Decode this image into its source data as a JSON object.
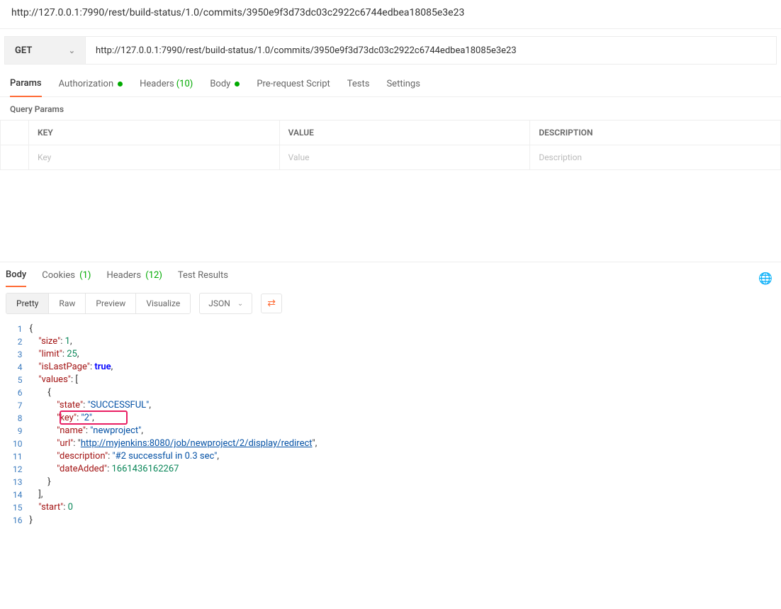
{
  "address_url": "http://127.0.0.1:7990/rest/build-status/1.0/commits/3950e9f3d73dc03c2922c6744edbea18085e3e23",
  "method": "GET",
  "request_url": "http://127.0.0.1:7990/rest/build-status/1.0/commits/3950e9f3d73dc03c2922c6744edbea18085e3e23",
  "req_tabs": {
    "params": "Params",
    "auth": "Authorization",
    "headers": "Headers",
    "headers_count": "(10)",
    "body": "Body",
    "prescript": "Pre-request Script",
    "tests": "Tests",
    "settings": "Settings"
  },
  "query_params_title": "Query Params",
  "table": {
    "key_h": "KEY",
    "value_h": "VALUE",
    "desc_h": "DESCRIPTION",
    "key_ph": "Key",
    "value_ph": "Value",
    "desc_ph": "Description"
  },
  "resp_tabs": {
    "body": "Body",
    "cookies": "Cookies",
    "cookies_count": "(1)",
    "headers": "Headers",
    "headers_count": "(12)",
    "tests": "Test Results"
  },
  "view_modes": {
    "pretty": "Pretty",
    "raw": "Raw",
    "preview": "Preview",
    "visualize": "Visualize"
  },
  "format": "JSON",
  "json": {
    "size_k": "\"size\"",
    "size_v": "1",
    "limit_k": "\"limit\"",
    "limit_v": "25",
    "islast_k": "\"isLastPage\"",
    "islast_v": "true",
    "values_k": "\"values\"",
    "state_k": "\"state\"",
    "state_v": "\"SUCCESSFUL\"",
    "key_k": "\"key\"",
    "key_v": "\"2\"",
    "name_k": "\"name\"",
    "name_v": "\"newproject\"",
    "url_k": "\"url\"",
    "url_v": "http://myjenkins:8080/job/newproject/2/display/redirect",
    "desc_k": "\"description\"",
    "desc_v": "\"#2 successful in 0.3 sec\"",
    "date_k": "\"dateAdded\"",
    "date_v": "1661436162267",
    "start_k": "\"start\"",
    "start_v": "0"
  },
  "line_numbers": [
    "1",
    "2",
    "3",
    "4",
    "5",
    "6",
    "7",
    "8",
    "9",
    "10",
    "11",
    "12",
    "13",
    "14",
    "15",
    "16"
  ]
}
